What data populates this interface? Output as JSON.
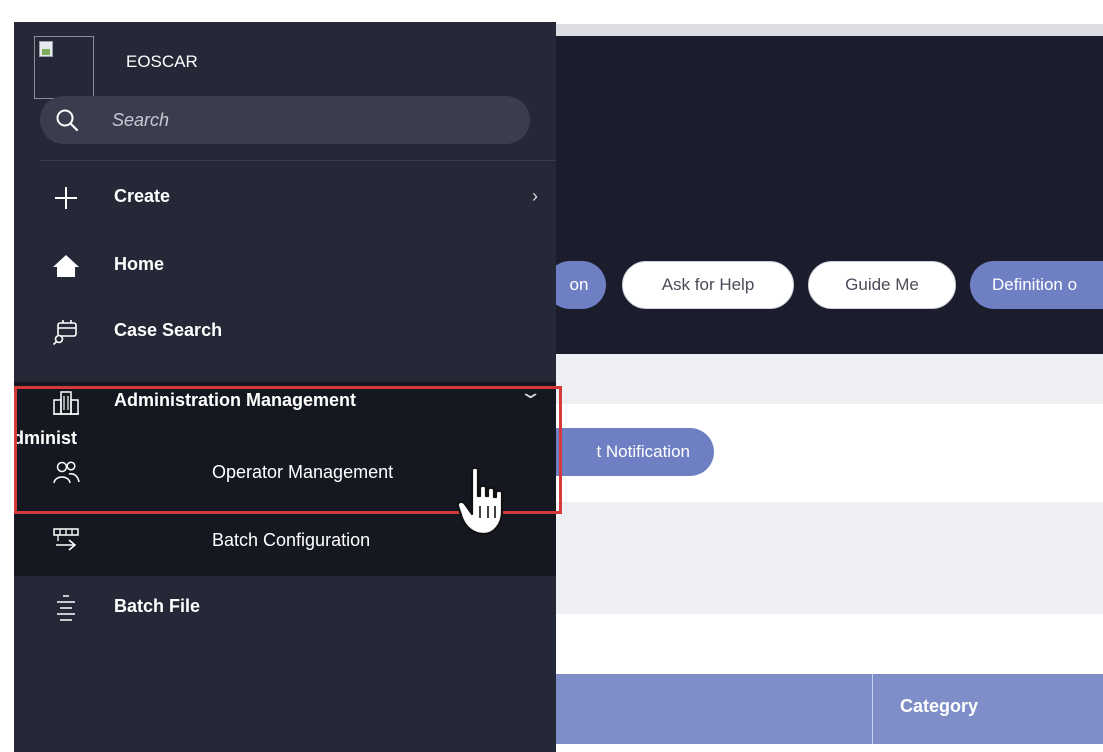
{
  "app": {
    "name": "EOSCAR"
  },
  "search": {
    "placeholder": "Search"
  },
  "nav": {
    "create": "Create",
    "home": "Home",
    "case_search": "Case Search",
    "admin_management": "Administration Management",
    "admin_truncated": "Administ",
    "operator_management": "Operator Management",
    "batch_configuration": "Batch Configuration",
    "batch_file": "Batch File"
  },
  "icons": {
    "create": "plus-icon",
    "home": "home-icon",
    "case_search": "case-search-icon",
    "admin": "building-icon",
    "operator": "users-icon",
    "batch_config": "batch-config-icon",
    "batch_file": "list-icon",
    "create_chevron": "chevron-right-icon",
    "admin_chevron": "chevron-down-icon"
  },
  "toolbar": {
    "partial_left": "on",
    "ask_for_help": "Ask for Help",
    "guide_me": "Guide Me",
    "definition": "Definition o"
  },
  "content": {
    "notification_button": "t Notification",
    "table_col_category": "Category"
  },
  "colors": {
    "sidebar_bg": "#252837",
    "submenu_bg": "#161821",
    "header_bg": "#1b1d2d",
    "accent_blue": "#6e7fc4",
    "table_header": "#7f8ec8",
    "highlight_border": "#d6393a"
  }
}
